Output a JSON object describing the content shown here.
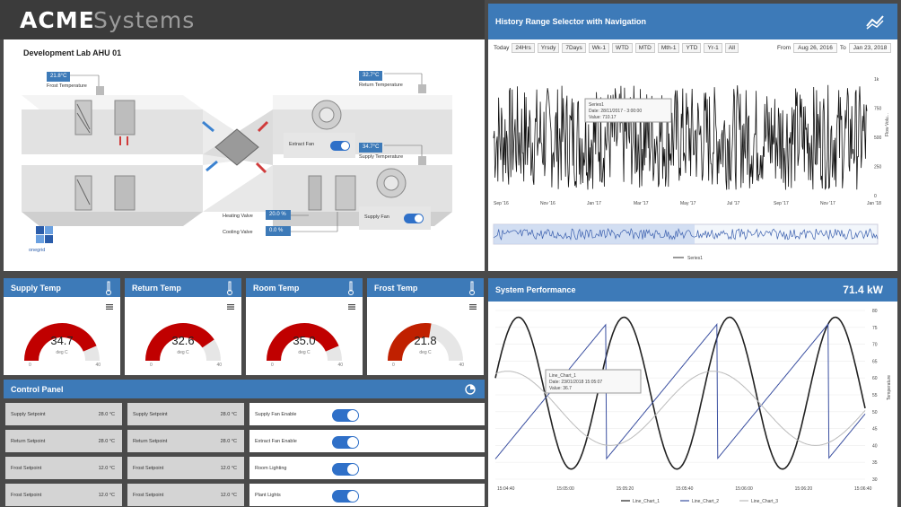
{
  "brand": {
    "part1": "ACME",
    "part2": "Systems"
  },
  "ahu": {
    "title": "Development Lab AHU 01",
    "frost": {
      "value": "21.8°C",
      "label": "Frost Temperature"
    },
    "return": {
      "value": "32.7°C",
      "label": "Return Temperature"
    },
    "supply": {
      "value": "34.7°C",
      "label": "Supply Temperature"
    },
    "extract_fan": "Extract Fan",
    "supply_fan": "Supply Fan",
    "heating": {
      "label": "Heating Valve",
      "value": "20.0 %"
    },
    "cooling": {
      "label": "Cooling Valve",
      "value": "0.0 %"
    },
    "logo": "onegrid"
  },
  "history": {
    "title": "History Range Selector with Navigation",
    "ranges": [
      "Today",
      "24Hrs",
      "Yrsdy",
      "7Days",
      "Wk-1",
      "WTD",
      "MTD",
      "Mth-1",
      "YTD",
      "Yr-1",
      "All"
    ],
    "from_label": "From",
    "from": "Aug 26, 2016",
    "to_label": "To",
    "to": "Jan 23, 2018",
    "xticks": [
      "Sep '16",
      "Nov '16",
      "Jan '17",
      "Mar '17",
      "May '17",
      "Jul '17",
      "Sep '17",
      "Nov '17",
      "Jan '18"
    ],
    "yticks": [
      "1k",
      "750",
      "500",
      "250",
      "0"
    ],
    "ylabel": "Flow Volu...",
    "tooltip": [
      "Series1",
      "Date: 28/11/2017 - 3:00:00",
      "Value: 710.17"
    ],
    "legend": "Series1",
    "chart_data": {
      "type": "line",
      "x_range": [
        "Sep '16",
        "Jan '18"
      ],
      "ylim": [
        0,
        1000
      ],
      "series": [
        {
          "name": "Series1",
          "pattern": "noisy",
          "mean": 500,
          "min": 50,
          "max": 950
        }
      ]
    }
  },
  "gauges": [
    {
      "title": "Supply Temp",
      "value": "34.7",
      "unit": "deg C",
      "min": "0",
      "max": "40",
      "fraction": 0.87,
      "color": "#c00000"
    },
    {
      "title": "Return Temp",
      "value": "32.6",
      "unit": "deg C",
      "min": "0",
      "max": "40",
      "fraction": 0.81,
      "color": "#c00000"
    },
    {
      "title": "Room Temp",
      "value": "35.0",
      "unit": "deg C",
      "min": "0",
      "max": "40",
      "fraction": 0.87,
      "color": "#c00000"
    },
    {
      "title": "Frost Temp",
      "value": "21.8",
      "unit": "deg C",
      "min": "0",
      "max": "40",
      "fraction": 0.55,
      "color": "#c02000"
    }
  ],
  "control": {
    "title": "Control Panel",
    "setpoints": [
      {
        "label": "Supply Setpoint",
        "value": "28.0 °C"
      },
      {
        "label": "Return Setpoint",
        "value": "28.0 °C"
      },
      {
        "label": "Frost Setpoint",
        "value": "12.0 °C"
      },
      {
        "label": "Frost Setpoint",
        "value": "12.0 °C"
      }
    ],
    "switches": [
      {
        "label": "Supply Fan Enable",
        "on": true
      },
      {
        "label": "Extract Fan Enable",
        "on": true
      },
      {
        "label": "Room Lighting",
        "on": true
      },
      {
        "label": "Plant Lights",
        "on": true
      }
    ]
  },
  "perf": {
    "title": "System Performance",
    "kw": "71.4 kW",
    "yticks": [
      "80",
      "75",
      "70",
      "65",
      "60",
      "55",
      "50",
      "45",
      "40",
      "35",
      "30"
    ],
    "xticks": [
      "15:04:40",
      "15:05:00",
      "15:05:20",
      "15:05:40",
      "15:06:00",
      "15:06:20",
      "15:06:40"
    ],
    "ylabel": "Temperature",
    "tooltip": [
      "Line_Chart_1",
      "Date: 23/01/2018  15:05:07",
      "Value: 36.7"
    ],
    "legend": [
      "Line_Chart_1",
      "Line_Chart_2",
      "Line_Chart_3"
    ],
    "colors": [
      "#222222",
      "#3a4fa0",
      "#bbbbbb"
    ],
    "chart_data": {
      "type": "line",
      "x_range": [
        "15:04:40",
        "15:06:40"
      ],
      "ylim": [
        30,
        80
      ],
      "series": [
        {
          "name": "Line_Chart_1",
          "pattern": "sine",
          "cycles": 3.5,
          "min": 33,
          "max": 78
        },
        {
          "name": "Line_Chart_2",
          "pattern": "sawtooth",
          "period_fraction": 0.3,
          "min": 36,
          "max": 76
        },
        {
          "name": "Line_Chart_3",
          "pattern": "sine",
          "cycles": 1.8,
          "min": 40,
          "max": 62
        }
      ]
    }
  }
}
